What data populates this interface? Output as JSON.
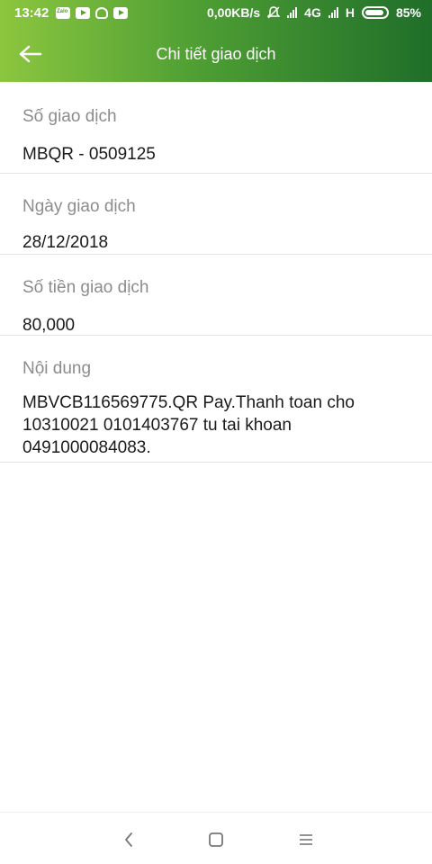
{
  "status_bar": {
    "time": "13:42",
    "speed": "0,00KB/s",
    "network": "4G",
    "network2": "H",
    "battery": "85%"
  },
  "header": {
    "title": "Chi tiết giao dịch"
  },
  "details": [
    {
      "label": "Số giao dịch",
      "value": "MBQR - 0509125"
    },
    {
      "label": "Ngày giao dịch",
      "value": "28/12/2018"
    },
    {
      "label": "Số tiền giao dịch",
      "value": "80,000"
    },
    {
      "label": "Nội dung",
      "value": "MBVCB116569775.QR Pay.Thanh toan cho 10310021 0101403767 tu tai khoan 0491000084083."
    }
  ],
  "icons": {
    "back": "arrow-left-icon",
    "nav_back": "chevron-left-icon",
    "nav_home": "square-home-icon",
    "nav_menu": "hamburger-menu-icon"
  },
  "colors": {
    "header_gradient_start": "#8cc63f",
    "header_gradient_end": "#1f6e2a"
  }
}
